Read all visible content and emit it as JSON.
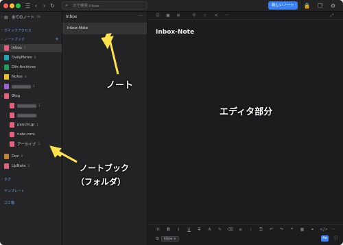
{
  "toolbar": {
    "search_placeholder": "次で検索 Inbox",
    "new_note_label": "新しいノート"
  },
  "sidebar": {
    "all_notes": {
      "label": "全てのノート",
      "count": "78"
    },
    "quick_access": "クイックアクセス",
    "notebooks_section": "ノートブック",
    "notebooks": [
      {
        "label": "Inbox",
        "count": "1",
        "color": "#e0607e"
      },
      {
        "label": "DailyNotes",
        "count": "6",
        "color": "#1aa6b3"
      },
      {
        "label": "Dfn-Archives",
        "count": "",
        "color": "#1f9e5a"
      },
      {
        "label": "Notes",
        "count": "4",
        "color": "#e6c229"
      },
      {
        "label": "",
        "count": "1",
        "color": "#a062d6"
      },
      {
        "label": "Blog",
        "count": "",
        "color": "#e0607e"
      },
      {
        "label": "",
        "count": "1",
        "color": "#e0607e"
      },
      {
        "label": "",
        "count": "",
        "color": "#e0607e"
      },
      {
        "label": "penchi.jp",
        "count": "1",
        "color": "#e0607e"
      },
      {
        "label": "note.com",
        "count": "",
        "color": "#e0607e"
      },
      {
        "label": "アーカイブ",
        "count": "3",
        "color": "#e0607e"
      },
      {
        "label": "Doc",
        "count": "2",
        "color": "#c0803a"
      },
      {
        "label": "UpNote",
        "count": "2",
        "color": "#e0607e"
      }
    ],
    "tags": "タグ",
    "templates": "テンプレート",
    "trash": "ゴミ箱"
  },
  "note_list": {
    "title": "Inbox",
    "notes": [
      {
        "title": "Inbox-Note"
      }
    ]
  },
  "editor": {
    "title": "Inbox-Note",
    "tag": "Inbox",
    "font_button": "Aa"
  },
  "annotations": {
    "note": "ノート",
    "editor": "エディタ部分",
    "notebook_line1": "ノートブック",
    "notebook_line2": "（フォルダ）"
  }
}
